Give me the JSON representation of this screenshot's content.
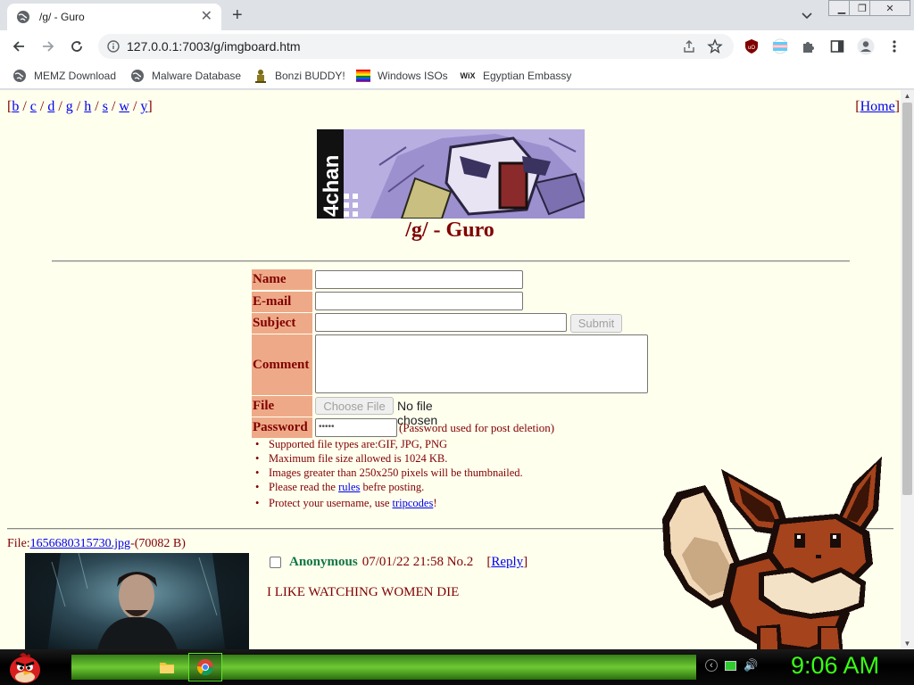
{
  "browser": {
    "tab": {
      "title": "/g/ - Guro",
      "icon": "globe-icon"
    },
    "address": {
      "url": "127.0.0.1:7003/g/imgboard.htm"
    },
    "bookmarks": [
      {
        "label": "MEMZ Download",
        "icon": "globe-icon"
      },
      {
        "label": "Malware Database",
        "icon": "globe-icon"
      },
      {
        "label": "Bonzi BUDDY!",
        "icon": "bonzi-icon"
      },
      {
        "label": "Windows ISOs",
        "icon": "windows-flag-icon"
      },
      {
        "label": "Egyptian Embassy",
        "icon": "wix-icon",
        "icon_text": "WiX"
      }
    ]
  },
  "page": {
    "board_nav": {
      "open": "[",
      "close": "]",
      "sep": " / ",
      "boards": [
        "b",
        "c",
        "d",
        "g",
        "h",
        "s",
        "w",
        "y"
      ]
    },
    "home_nav": {
      "open": "[",
      "label": "Home",
      "close": "]"
    },
    "banner_text": "4chan",
    "board_title": "/g/ - Guro",
    "form": {
      "name_label": "Name",
      "email_label": "E-mail",
      "subject_label": "Subject",
      "comment_label": "Comment",
      "file_label": "File",
      "password_label": "Password",
      "submit_label": "Submit",
      "choose_file_label": "Choose File",
      "no_file_text": "No file chosen",
      "password_value": "•••••",
      "password_note": "(Password used for post deletion)"
    },
    "rules": {
      "file_types": "Supported file types are:GIF, JPG, PNG",
      "max_size": "Maximum file size allowed is 1024 KB.",
      "thumbnail": "Images greater than 250x250 pixels will be thumbnailed.",
      "rules_pre": "Please read the ",
      "rules_link": "rules",
      "rules_post": " befre posting.",
      "trip_pre": " Protect your username, use ",
      "trip_link": "tripcodes",
      "trip_post": "!"
    },
    "post": {
      "file_prefix": "File:",
      "file_name": "1656680315730.jpg",
      "file_size": "-(70082 B)",
      "name": "Anonymous",
      "datetime": "07/01/22 21:58",
      "number": "No.2",
      "reply_open": "[",
      "reply_label": "Reply",
      "reply_close": "]",
      "comment": "I LIKE WATCHING WOMEN DIE"
    }
  },
  "taskbar": {
    "clock": "9:06 AM",
    "accent": "#39ff14"
  }
}
